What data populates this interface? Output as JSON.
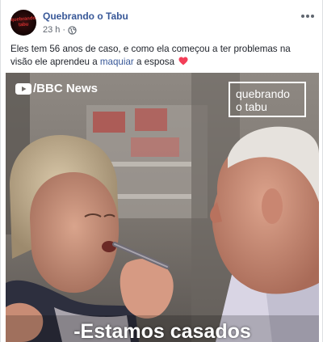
{
  "post": {
    "page_name": "Quebrando o Tabu",
    "avatar_text": "quebrando tabu",
    "timestamp": "23 h",
    "separator": "·",
    "privacy_icon": "globe-icon",
    "more_icon": "more-options-icon",
    "caption_before_link": "Eles tem 56 anos de caso, e como ela começou a ter problemas na visão ele aprendeu a ",
    "caption_link": "maquiar",
    "caption_after_link": " a esposa",
    "caption_emoji": "heart-icon"
  },
  "video": {
    "source_label": "/BBC News",
    "source_icon": "youtube-icon",
    "brand_line1": "quebrando",
    "brand_line2": "o tabu",
    "subtitle": "-Estamos casados"
  },
  "colors": {
    "link": "#385898",
    "text": "#1d2129",
    "meta": "#616770",
    "heart": "#f33e58"
  }
}
